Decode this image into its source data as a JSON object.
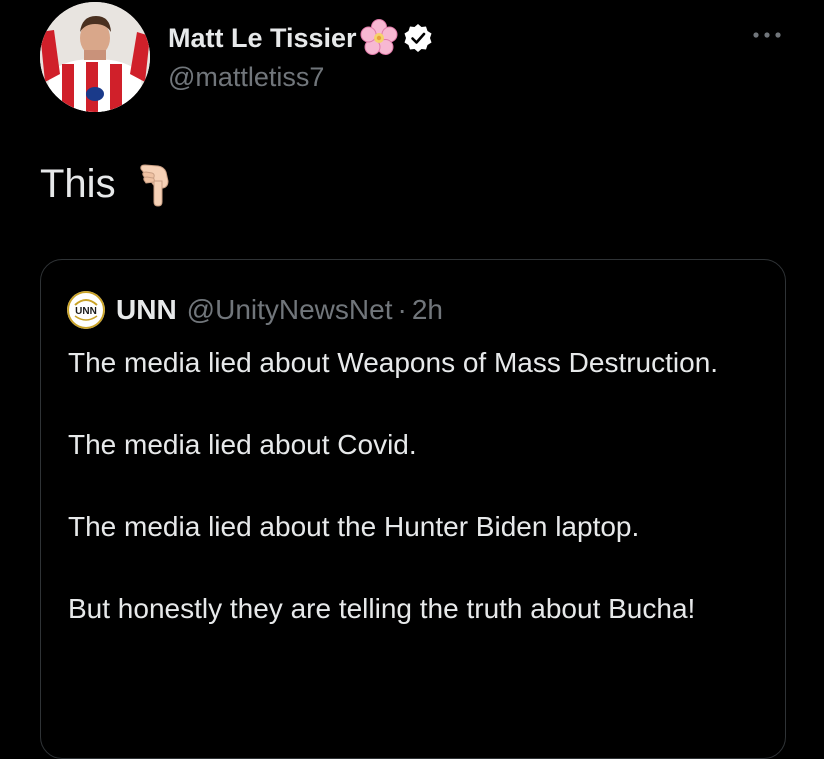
{
  "author": {
    "display_name": "Matt Le Tissier",
    "handle": "@mattletiss7",
    "emoji_icon": "cherry-blossom-icon",
    "verified_icon": "verified-badge-icon"
  },
  "tweet": {
    "text": "This",
    "emoji_icon": "pointing-down-hand-icon"
  },
  "more_icon": "more-options-icon",
  "quote": {
    "avatar_text": "UNN",
    "name": "UNN",
    "handle": "@UnityNewsNet",
    "separator": "·",
    "time": "2h",
    "paragraphs": [
      "The media lied about Weapons of Mass Destruction.",
      "The media lied about Covid.",
      "The media lied about the Hunter Biden laptop.",
      "But honestly they are telling the truth about Bucha!"
    ]
  },
  "colors": {
    "background": "#000000",
    "text_primary": "#e7e9ea",
    "text_secondary": "#71767b",
    "border": "#2f3336",
    "unn_gold": "#c9a227"
  }
}
